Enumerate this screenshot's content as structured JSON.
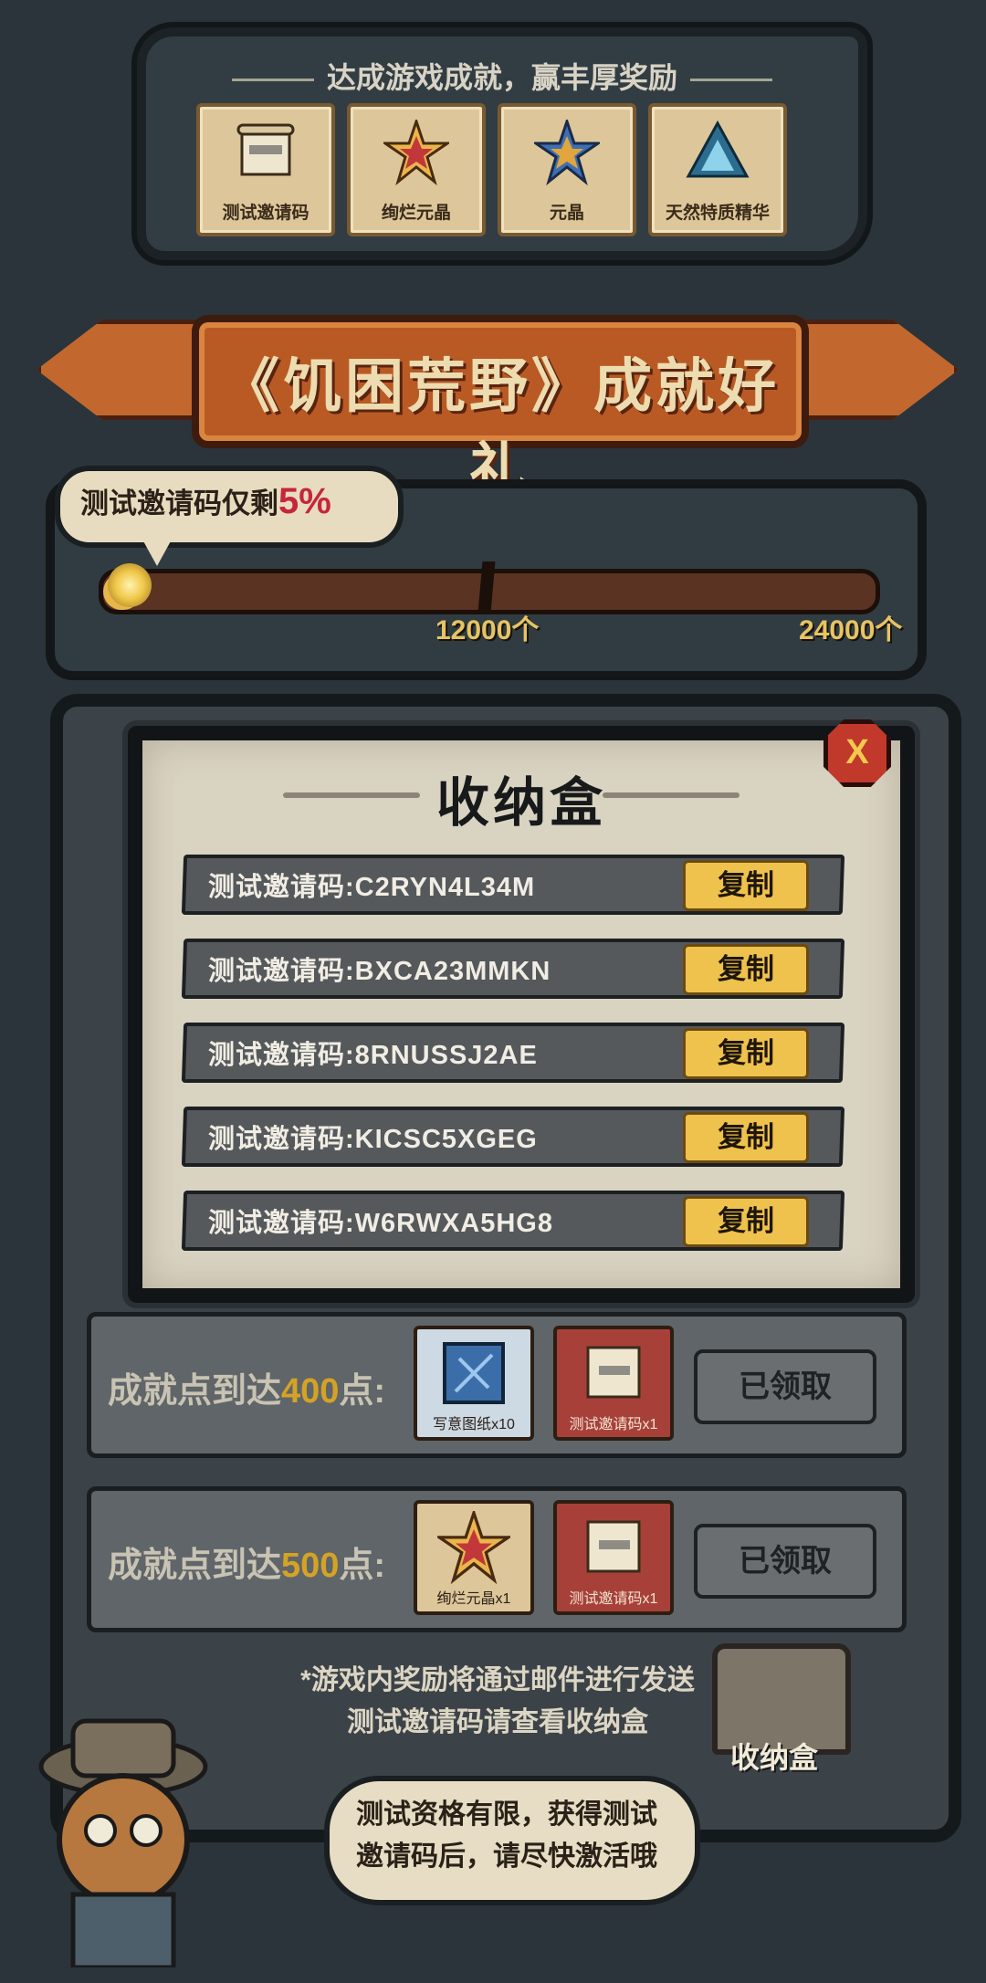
{
  "top_panel": {
    "title": "达成游戏成就，赢丰厚奖励",
    "rewards": [
      {
        "label": "测试邀请码",
        "icon": "scroll-icon"
      },
      {
        "label": "绚烂元晶",
        "icon": "star-gem-icon"
      },
      {
        "label": "元晶",
        "icon": "blue-star-gem-icon"
      },
      {
        "label": "天然特质精华",
        "icon": "crystal-icon"
      }
    ]
  },
  "banner": {
    "title": "《饥困荒野》成就好礼"
  },
  "progress": {
    "remaining_label": "测试邀请码仅剩",
    "remaining_percent": "5%",
    "fill_fraction": 0.05,
    "milestones": [
      "12000个",
      "24000个"
    ]
  },
  "modal": {
    "title": "收纳盒",
    "close_label": "X",
    "copy_label": "复制",
    "codes": [
      "测试邀请码:C2RYN4L34M",
      "测试邀请码:BXCA23MMKN",
      "测试邀请码:8RNUSSJ2AE",
      "测试邀请码:KICSC5XGEG",
      "测试邀请码:W6RWXA5HG8"
    ]
  },
  "achievements": [
    {
      "prefix": "成就点到达",
      "points": "400",
      "suffix": "点:",
      "items": [
        "写意图纸x10",
        "测试邀请码x1"
      ],
      "button": "已领取"
    },
    {
      "prefix": "成就点到达",
      "points": "500",
      "suffix": "点:",
      "items": [
        "绚烂元晶x1",
        "测试邀请码x1"
      ],
      "button": "已领取"
    }
  ],
  "note": {
    "line1": "*游戏内奖励将通过邮件进行发送",
    "line2": "测试邀请码请查看收纳盒"
  },
  "storage_box": {
    "label": "收纳盒"
  },
  "speech": {
    "line1": "测试资格有限，获得测试",
    "line2": "邀请码后，请尽快激活哦"
  },
  "colors": {
    "accent_gold": "#efc24d",
    "percent_red": "#c6263a",
    "banner_orange": "#b95a25"
  }
}
